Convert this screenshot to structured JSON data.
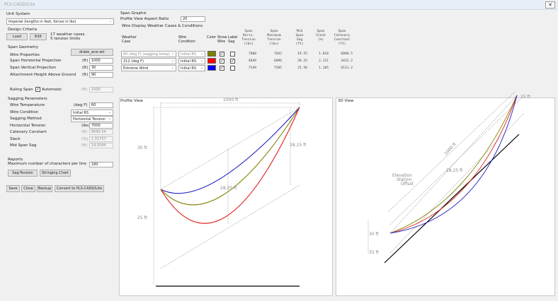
{
  "window": {
    "title": "PLS-CADD/Lite",
    "close_icon": "x"
  },
  "left": {
    "unit_system": {
      "label": "Unit System",
      "value": "Imperial (lengths in feet, forces in lbs)"
    },
    "design_criteria": {
      "label": "Design Criteria",
      "load": "Load",
      "edit": "Edit",
      "info1": "17 weather cases",
      "info2": "5 tension limits"
    },
    "span_geometry": {
      "label": "Span Geometry",
      "wire_properties": "Wire Properties",
      "wire_file": "drake_acsr.wir",
      "rows": [
        {
          "label": "Span Horizontal Projection",
          "unit": "(ft)",
          "value": "1000"
        },
        {
          "label": "Span Vertical Projection",
          "unit": "(ft)",
          "value": "30"
        },
        {
          "label": "Attachment Height Above Ground",
          "unit": "(ft)",
          "value": "90"
        }
      ],
      "ruling_span": "Ruling Span",
      "automatic": "Automatic",
      "ruling_unit": "(ft)",
      "ruling_value": "1000"
    },
    "sagging": {
      "label": "Sagging Parameters",
      "rows": [
        {
          "label": "Wire Temperature",
          "unit": "(deg F)",
          "value": "60"
        },
        {
          "label": "Wire Condition",
          "value": "Initial RS"
        },
        {
          "label": "Sagging Method",
          "value": "Horizontal Tension"
        },
        {
          "label": "Horizontal Tension",
          "unit": "(lbs)",
          "value": "7000"
        },
        {
          "label": "Catenary Constant",
          "unit": "(ft)",
          "value": "6090.54"
        },
        {
          "label": "Slack",
          "unit": "(%)",
          "value": "1.01757"
        },
        {
          "label": "Mid Span Sag",
          "unit": "(ft)",
          "value": "19.5544"
        }
      ]
    },
    "reports": {
      "label": "Reports",
      "max_chars": "Maximum number of characters per line",
      "max_value": "180",
      "sag_tension": "Sag-Tension",
      "stringing_chart": "Stringing Chart"
    },
    "bottom_buttons": [
      "Save",
      "Close",
      "Backup",
      "Convert to PLS-CADD/Lite"
    ]
  },
  "span_graphic": {
    "label": "Span Graphic",
    "aspect_label": "Profile View Aspect Ratio",
    "aspect_value": "20",
    "wire_display": "Wire Display Weather Cases & Conditions",
    "headers": [
      "Weather\nCase",
      "Wire\nCondition",
      "Color",
      "Show\nWire",
      "Label\nSag",
      "Span\nHoriz.\nTension\n(lbs)",
      "Span\nMaximum\nTension\n(lbs)",
      "Mid\nSpan\nSag\n(ft)",
      "Span\nSlack\n(%)",
      "Span\nCatenary\nConstant\n(ft)"
    ],
    "rows": [
      {
        "case": "60 (deg F) (sagging temp)",
        "condition": "Initial RS",
        "color": "#7f7f00",
        "show": true,
        "label": false,
        "values": [
          "7000",
          "7042",
          "19.55",
          "1.010",
          "6090.5"
        ],
        "disabled": true
      },
      {
        "case": "212 (deg F)",
        "condition": "Initial RS",
        "color": "#ff0000",
        "show": true,
        "label": true,
        "values": [
          "4849",
          "4896",
          "28.25",
          "2.121",
          "4432.2"
        ],
        "disabled": false
      },
      {
        "case": "Extreme Wind",
        "condition": "Initial RS",
        "color": "#0000ff",
        "show": true,
        "label": false,
        "values": [
          "7549",
          "7585",
          "25.50",
          "1.105",
          "6131.2"
        ],
        "disabled": false
      }
    ]
  },
  "profile": {
    "title": "Profile View",
    "span": "1000 ft",
    "left_height": "30 ft",
    "left_lower": "25 ft",
    "right_sag": "28.25 ft",
    "mid_sag": "28.25 ft"
  },
  "view3d": {
    "title": "3D View",
    "span": "1000 ft",
    "sag": "28.25 ft",
    "h1": "30 ft",
    "h2": "35 ft",
    "top": "25 ft",
    "axis1": "Elevation",
    "axis2": "Station",
    "axis3": "Offset"
  }
}
